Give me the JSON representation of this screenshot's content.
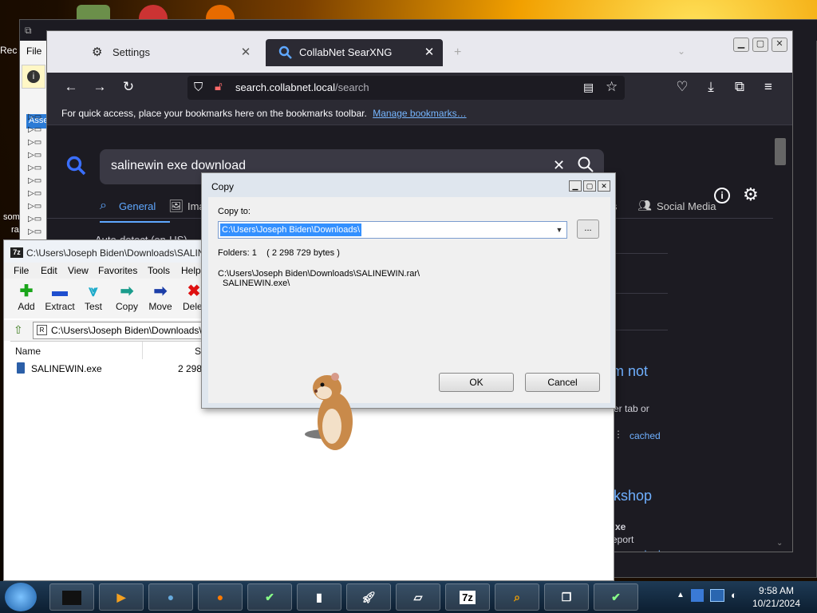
{
  "back_window": {
    "menu_file": "File",
    "left_asse": "Asse",
    "left_labels": [
      "Rec",
      "som",
      "ra"
    ]
  },
  "browser": {
    "tabs": [
      {
        "label": "Settings",
        "icon": "gear-icon"
      },
      {
        "label": "CollabNet SearXNG",
        "icon": "search-icon",
        "active": true
      }
    ],
    "url_host": "search.collabnet.local",
    "url_path": "/search",
    "bookmarks_message": "For quick access, place your bookmarks here on the bookmarks toolbar.",
    "bookmarks_link": "Manage bookmarks…",
    "search_query": "salinewin exe download",
    "categories": [
      "General",
      "Ima",
      "s",
      "Social Media"
    ],
    "autodetect_text": "Auto-detect (en-US)",
    "fragments": {
      "heading_fragment": "m not",
      "tab_text": "er tab or",
      "cached_1": "cached",
      "workshop": "kshop",
      "exe_fragment": "xe",
      "report_fragment": "eport",
      "cached_2": "cached"
    }
  },
  "sevenzip": {
    "title": "C:\\Users\\Joseph Biden\\Downloads\\SALIN",
    "menu": [
      "File",
      "Edit",
      "View",
      "Favorites",
      "Tools",
      "Help"
    ],
    "toolbar": [
      {
        "label": "Add",
        "icon": "add-icon",
        "color": "#1aa51a"
      },
      {
        "label": "Extract",
        "icon": "extract-icon",
        "color": "#1f4fcf"
      },
      {
        "label": "Test",
        "icon": "test-icon",
        "color": "#19a9c9"
      },
      {
        "label": "Copy",
        "icon": "copy-icon",
        "color": "#1a9c8c"
      },
      {
        "label": "Move",
        "icon": "move-icon",
        "color": "#1b3ea8"
      },
      {
        "label": "Delet",
        "icon": "delete-icon",
        "color": "#e01010"
      }
    ],
    "address": "C:\\Users\\Joseph Biden\\Downloads\\",
    "columns": [
      "Name",
      "S"
    ],
    "files": [
      {
        "name": "SALINEWIN.exe",
        "size": "2 298 7"
      }
    ]
  },
  "copy_dialog": {
    "title": "Copy",
    "copy_to_label": "Copy to:",
    "path_value": "C:\\Users\\Joseph Biden\\Downloads\\",
    "browse_label": "...",
    "info_line": "Folders: 1    ( 2 298 729 bytes )",
    "source_line1": "C:\\Users\\Joseph Biden\\Downloads\\SALINEWIN.rar\\",
    "source_line2": "SALINEWIN.exe\\",
    "ok_label": "OK",
    "cancel_label": "Cancel"
  },
  "taskbar": {
    "items": [
      "cmd-icon",
      "media-player-icon",
      "globe-icon",
      "firefox-icon",
      "checklist-icon",
      "terminal-icon",
      "rocket-icon",
      "notepad-icon",
      "7z-icon",
      "search-icon",
      "window-switch-icon",
      "checklist-icon"
    ],
    "sevenzip_label": "7z",
    "time": "9:58 AM",
    "date": "10/21/2024"
  },
  "colors": {
    "browser_bg": "#1c1b22",
    "accent_blue": "#5fa8ff",
    "selection": "#3390ff"
  }
}
